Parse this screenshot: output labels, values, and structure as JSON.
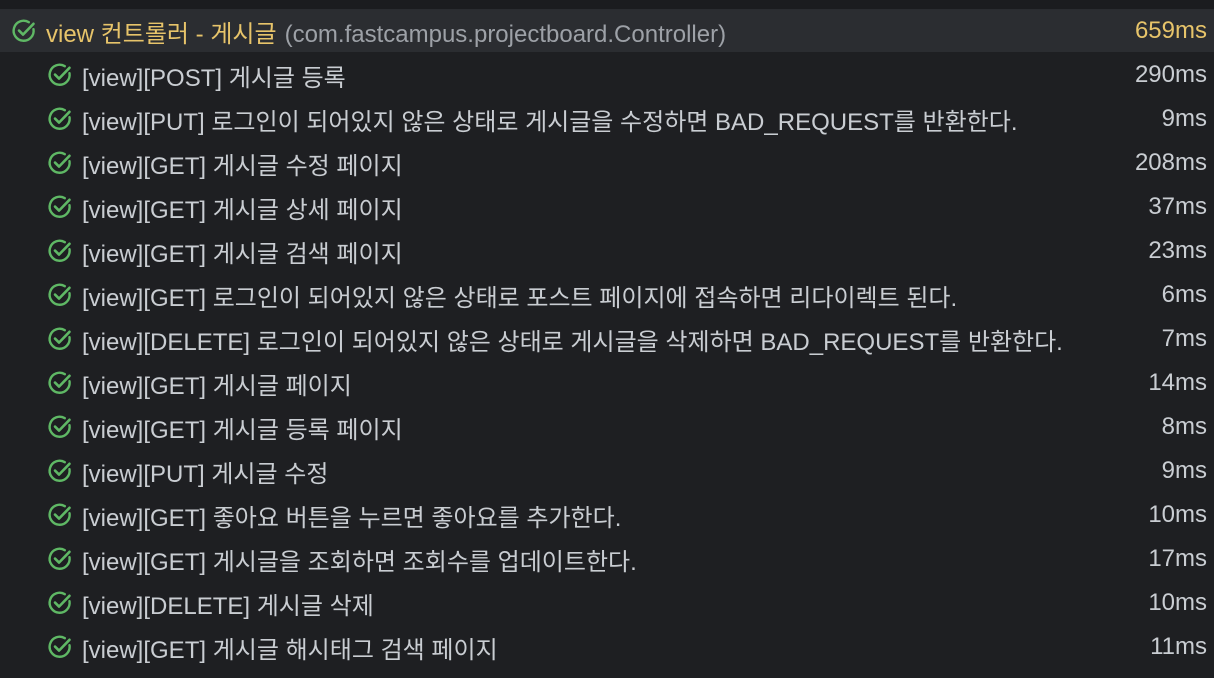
{
  "parent": {
    "name": "view 컨트롤러 - 게시글",
    "package": "(com.fastcampus.projectboard.Controller)",
    "time": "659ms",
    "status": "passed"
  },
  "tests": [
    {
      "label": "[view][POST] 게시글 등록",
      "time": "290ms",
      "status": "passed"
    },
    {
      "label": "[view][PUT] 로그인이 되어있지 않은 상태로 게시글을 수정하면 BAD_REQUEST를 반환한다.",
      "time": "9ms",
      "status": "passed"
    },
    {
      "label": "[view][GET] 게시글 수정 페이지",
      "time": "208ms",
      "status": "passed"
    },
    {
      "label": "[view][GET] 게시글 상세 페이지",
      "time": "37ms",
      "status": "passed"
    },
    {
      "label": "[view][GET] 게시글 검색 페이지",
      "time": "23ms",
      "status": "passed"
    },
    {
      "label": "[view][GET] 로그인이 되어있지 않은 상태로 포스트 페이지에 접속하면 리다이렉트 된다.",
      "time": "6ms",
      "status": "passed"
    },
    {
      "label": "[view][DELETE] 로그인이 되어있지 않은 상태로 게시글을 삭제하면 BAD_REQUEST를 반환한다.",
      "time": "7ms",
      "status": "passed"
    },
    {
      "label": "[view][GET] 게시글 페이지",
      "time": "14ms",
      "status": "passed"
    },
    {
      "label": "[view][GET] 게시글 등록 페이지",
      "time": "8ms",
      "status": "passed"
    },
    {
      "label": "[view][PUT] 게시글 수정",
      "time": "9ms",
      "status": "passed"
    },
    {
      "label": "[view][GET] 좋아요 버튼을 누르면 좋아요를 추가한다.",
      "time": "10ms",
      "status": "passed"
    },
    {
      "label": "[view][GET] 게시글을 조회하면 조회수를 업데이트한다.",
      "time": "17ms",
      "status": "passed"
    },
    {
      "label": "[view][DELETE] 게시글 삭제",
      "time": "10ms",
      "status": "passed"
    },
    {
      "label": "[view][GET] 게시글 해시태그 검색 페이지",
      "time": "11ms",
      "status": "passed"
    }
  ],
  "icons": {
    "passed": "check-circle-icon"
  },
  "colors": {
    "background": "#1e1f22",
    "selected_row": "#2b2d31",
    "pass_icon": "#5fb865",
    "parent_text": "#e7c46a",
    "package_text": "#9da1a7",
    "test_text": "#c9cdd2"
  }
}
